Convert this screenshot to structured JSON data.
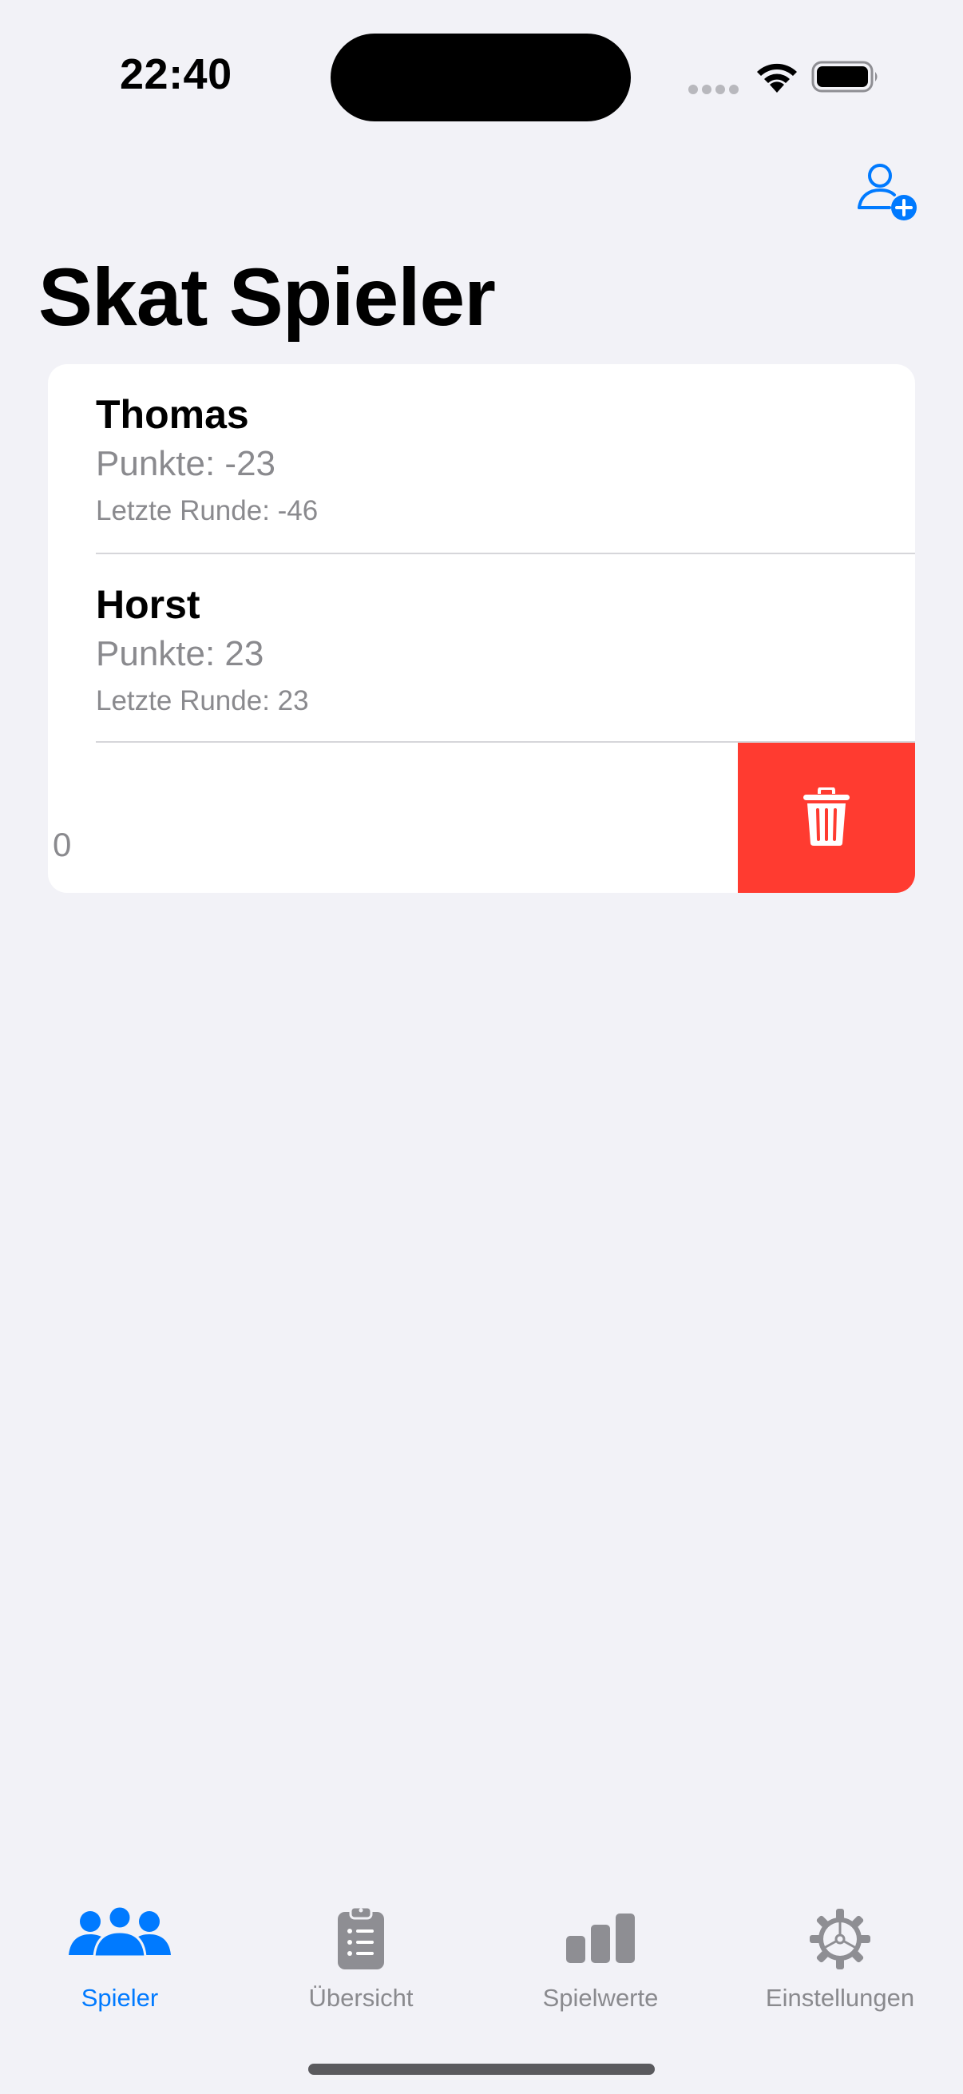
{
  "status_bar": {
    "time": "22:40"
  },
  "header": {
    "title": "Skat Spieler",
    "add_player_icon": "person-badge-plus-icon"
  },
  "players": [
    {
      "name": "Thomas",
      "points": "Punkte: -23",
      "last_round": "Letzte Runde: -46"
    },
    {
      "name": "Horst",
      "points": "Punkte: 23",
      "last_round": "Letzte Runde: 23"
    }
  ],
  "swiped_row": {
    "value": "0",
    "delete_icon": "trash-icon"
  },
  "tabs": [
    {
      "label": "Spieler",
      "icon": "person-3-icon",
      "active": true
    },
    {
      "label": "Übersicht",
      "icon": "clipboard-list-icon",
      "active": false
    },
    {
      "label": "Spielwerte",
      "icon": "chart-bar-icon",
      "active": false
    },
    {
      "label": "Einstellungen",
      "icon": "gear-icon",
      "active": false
    }
  ],
  "colors": {
    "accent": "#007aff",
    "destructive": "#ff3b30",
    "background": "#f2f2f7",
    "secondary_text": "#8a8a8e"
  }
}
